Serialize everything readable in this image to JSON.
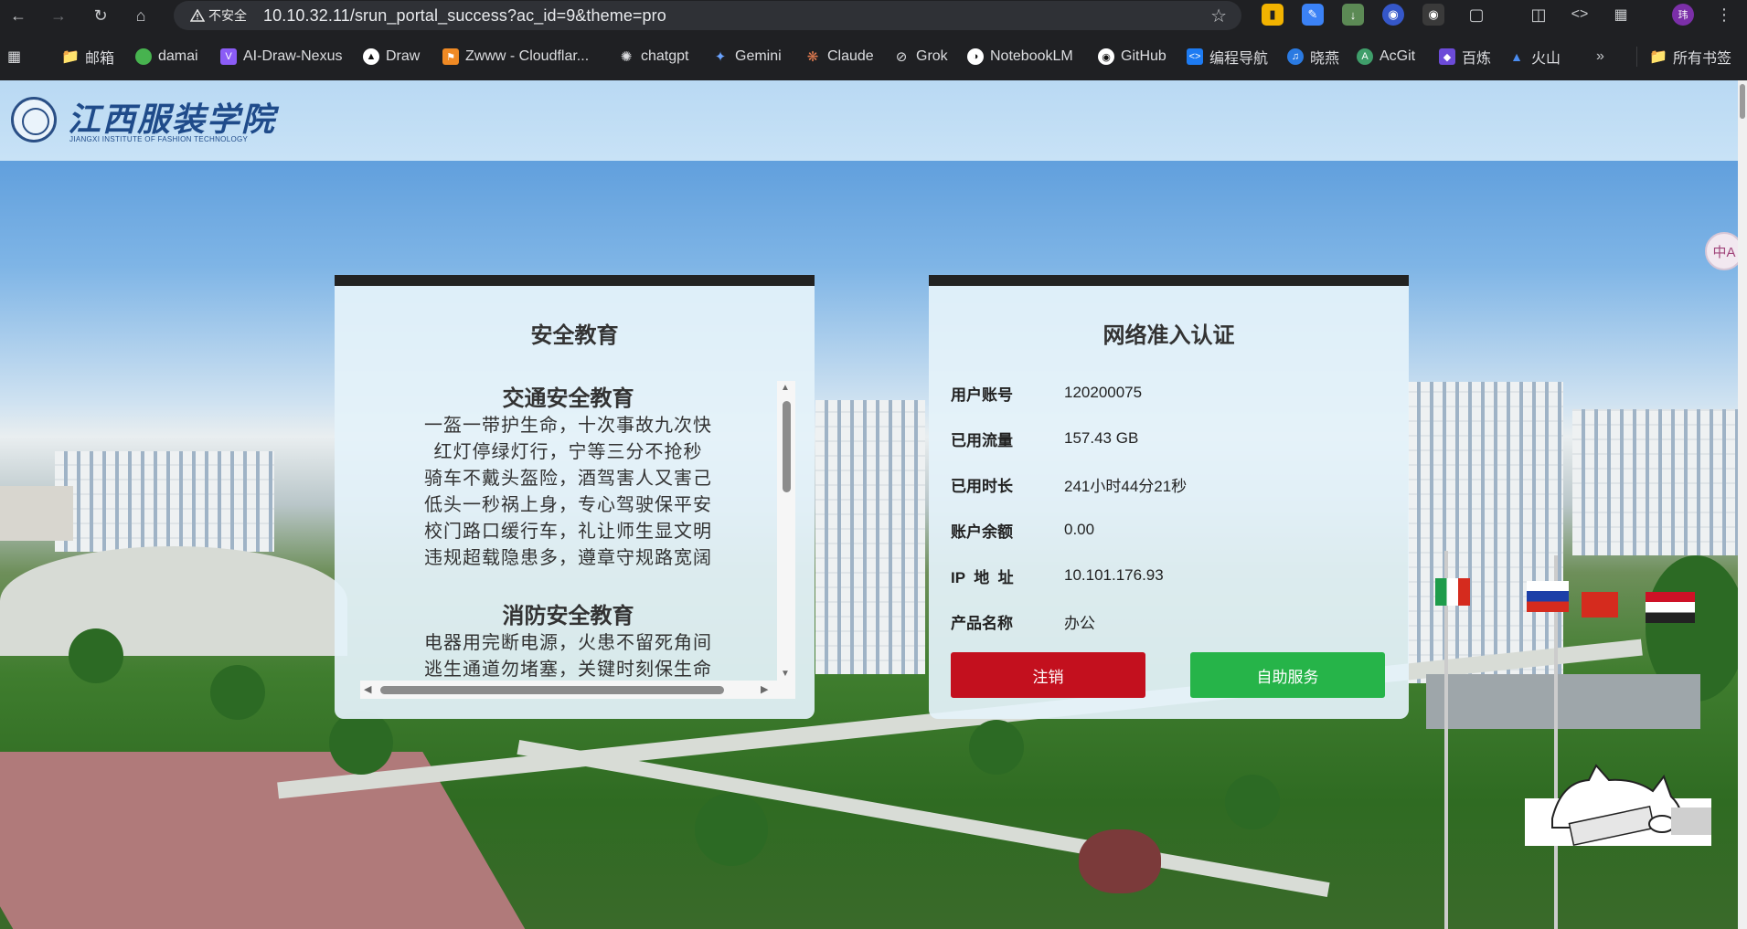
{
  "browser": {
    "security_label": "不安全",
    "url": "10.10.32.11/srun_portal_success?ac_id=9&theme=pro",
    "profile_initial": "玮",
    "bookmarks": [
      {
        "label": "邮箱",
        "icon": "folder-icon"
      },
      {
        "label": "damai",
        "icon": "damai-icon"
      },
      {
        "label": "AI-Draw-Nexus",
        "icon": "ai-draw-icon"
      },
      {
        "label": "Draw",
        "icon": "draw-icon"
      },
      {
        "label": "Zwww - Cloudflar...",
        "icon": "cloudflare-icon"
      },
      {
        "label": "chatgpt",
        "icon": "chatgpt-icon"
      },
      {
        "label": "Gemini",
        "icon": "gemini-icon"
      },
      {
        "label": "Claude",
        "icon": "claude-icon"
      },
      {
        "label": "Grok",
        "icon": "grok-icon"
      },
      {
        "label": "NotebookLM",
        "icon": "notebooklm-icon"
      },
      {
        "label": "GitHub",
        "icon": "github-icon"
      },
      {
        "label": "编程导航",
        "icon": "code-nav-icon"
      },
      {
        "label": "晓燕",
        "icon": "xiaoyan-icon"
      },
      {
        "label": "AcGit",
        "icon": "acgit-icon"
      },
      {
        "label": "百炼",
        "icon": "bailian-icon"
      },
      {
        "label": "火山",
        "icon": "volcano-icon"
      }
    ],
    "all_bookmarks_label": "所有书签"
  },
  "site": {
    "logo_cn": "江西服装学院",
    "logo_en": "JIANGXI INSTITUTE OF FASHION TECHNOLOGY"
  },
  "education": {
    "title": "安全教育",
    "sections": [
      {
        "heading": "交通安全教育",
        "lines": [
          "一盔一带护生命，十次事故九次快",
          "红灯停绿灯行，宁等三分不抢秒",
          "骑车不戴头盔险，酒驾害人又害己",
          "低头一秒祸上身，专心驾驶保平安",
          "校门路口缓行车，礼让师生显文明",
          "违规超载隐患多，遵章守规路宽阔"
        ]
      },
      {
        "heading": "消防安全教育",
        "lines": [
          "电器用完断电源，火患不留死角间",
          "逃生通道勿堵塞，关键时刻保生命"
        ]
      }
    ]
  },
  "auth": {
    "title": "网络准入认证",
    "rows": [
      {
        "key": "用户账号",
        "value": "120200075"
      },
      {
        "key": "已用流量",
        "value": "157.43 GB"
      },
      {
        "key": "已用时长",
        "value": "241小时44分21秒"
      },
      {
        "key": "账户余额",
        "value": "0.00"
      },
      {
        "key": "IP  地  址",
        "value": "10.101.176.93"
      },
      {
        "key": "产品名称",
        "value": "办公"
      }
    ],
    "logout_label": "注销",
    "self_service_label": "自助服务",
    "colors": {
      "logout": "#c3101e",
      "self_service": "#26b449"
    }
  },
  "floating": {
    "translate_label": "中A"
  }
}
